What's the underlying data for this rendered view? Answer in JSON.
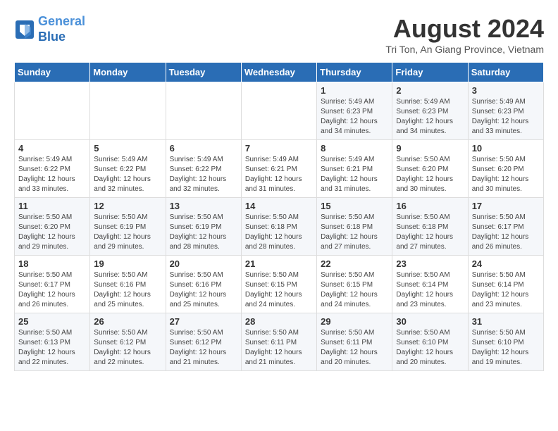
{
  "header": {
    "logo_line1": "General",
    "logo_line2": "Blue",
    "title": "August 2024",
    "subtitle": "Tri Ton, An Giang Province, Vietnam"
  },
  "calendar": {
    "weekdays": [
      "Sunday",
      "Monday",
      "Tuesday",
      "Wednesday",
      "Thursday",
      "Friday",
      "Saturday"
    ],
    "weeks": [
      [
        {
          "day": "",
          "detail": ""
        },
        {
          "day": "",
          "detail": ""
        },
        {
          "day": "",
          "detail": ""
        },
        {
          "day": "",
          "detail": ""
        },
        {
          "day": "1",
          "detail": "Sunrise: 5:49 AM\nSunset: 6:23 PM\nDaylight: 12 hours\nand 34 minutes."
        },
        {
          "day": "2",
          "detail": "Sunrise: 5:49 AM\nSunset: 6:23 PM\nDaylight: 12 hours\nand 34 minutes."
        },
        {
          "day": "3",
          "detail": "Sunrise: 5:49 AM\nSunset: 6:23 PM\nDaylight: 12 hours\nand 33 minutes."
        }
      ],
      [
        {
          "day": "4",
          "detail": "Sunrise: 5:49 AM\nSunset: 6:22 PM\nDaylight: 12 hours\nand 33 minutes."
        },
        {
          "day": "5",
          "detail": "Sunrise: 5:49 AM\nSunset: 6:22 PM\nDaylight: 12 hours\nand 32 minutes."
        },
        {
          "day": "6",
          "detail": "Sunrise: 5:49 AM\nSunset: 6:22 PM\nDaylight: 12 hours\nand 32 minutes."
        },
        {
          "day": "7",
          "detail": "Sunrise: 5:49 AM\nSunset: 6:21 PM\nDaylight: 12 hours\nand 31 minutes."
        },
        {
          "day": "8",
          "detail": "Sunrise: 5:49 AM\nSunset: 6:21 PM\nDaylight: 12 hours\nand 31 minutes."
        },
        {
          "day": "9",
          "detail": "Sunrise: 5:50 AM\nSunset: 6:20 PM\nDaylight: 12 hours\nand 30 minutes."
        },
        {
          "day": "10",
          "detail": "Sunrise: 5:50 AM\nSunset: 6:20 PM\nDaylight: 12 hours\nand 30 minutes."
        }
      ],
      [
        {
          "day": "11",
          "detail": "Sunrise: 5:50 AM\nSunset: 6:20 PM\nDaylight: 12 hours\nand 29 minutes."
        },
        {
          "day": "12",
          "detail": "Sunrise: 5:50 AM\nSunset: 6:19 PM\nDaylight: 12 hours\nand 29 minutes."
        },
        {
          "day": "13",
          "detail": "Sunrise: 5:50 AM\nSunset: 6:19 PM\nDaylight: 12 hours\nand 28 minutes."
        },
        {
          "day": "14",
          "detail": "Sunrise: 5:50 AM\nSunset: 6:18 PM\nDaylight: 12 hours\nand 28 minutes."
        },
        {
          "day": "15",
          "detail": "Sunrise: 5:50 AM\nSunset: 6:18 PM\nDaylight: 12 hours\nand 27 minutes."
        },
        {
          "day": "16",
          "detail": "Sunrise: 5:50 AM\nSunset: 6:18 PM\nDaylight: 12 hours\nand 27 minutes."
        },
        {
          "day": "17",
          "detail": "Sunrise: 5:50 AM\nSunset: 6:17 PM\nDaylight: 12 hours\nand 26 minutes."
        }
      ],
      [
        {
          "day": "18",
          "detail": "Sunrise: 5:50 AM\nSunset: 6:17 PM\nDaylight: 12 hours\nand 26 minutes."
        },
        {
          "day": "19",
          "detail": "Sunrise: 5:50 AM\nSunset: 6:16 PM\nDaylight: 12 hours\nand 25 minutes."
        },
        {
          "day": "20",
          "detail": "Sunrise: 5:50 AM\nSunset: 6:16 PM\nDaylight: 12 hours\nand 25 minutes."
        },
        {
          "day": "21",
          "detail": "Sunrise: 5:50 AM\nSunset: 6:15 PM\nDaylight: 12 hours\nand 24 minutes."
        },
        {
          "day": "22",
          "detail": "Sunrise: 5:50 AM\nSunset: 6:15 PM\nDaylight: 12 hours\nand 24 minutes."
        },
        {
          "day": "23",
          "detail": "Sunrise: 5:50 AM\nSunset: 6:14 PM\nDaylight: 12 hours\nand 23 minutes."
        },
        {
          "day": "24",
          "detail": "Sunrise: 5:50 AM\nSunset: 6:14 PM\nDaylight: 12 hours\nand 23 minutes."
        }
      ],
      [
        {
          "day": "25",
          "detail": "Sunrise: 5:50 AM\nSunset: 6:13 PM\nDaylight: 12 hours\nand 22 minutes."
        },
        {
          "day": "26",
          "detail": "Sunrise: 5:50 AM\nSunset: 6:12 PM\nDaylight: 12 hours\nand 22 minutes."
        },
        {
          "day": "27",
          "detail": "Sunrise: 5:50 AM\nSunset: 6:12 PM\nDaylight: 12 hours\nand 21 minutes."
        },
        {
          "day": "28",
          "detail": "Sunrise: 5:50 AM\nSunset: 6:11 PM\nDaylight: 12 hours\nand 21 minutes."
        },
        {
          "day": "29",
          "detail": "Sunrise: 5:50 AM\nSunset: 6:11 PM\nDaylight: 12 hours\nand 20 minutes."
        },
        {
          "day": "30",
          "detail": "Sunrise: 5:50 AM\nSunset: 6:10 PM\nDaylight: 12 hours\nand 20 minutes."
        },
        {
          "day": "31",
          "detail": "Sunrise: 5:50 AM\nSunset: 6:10 PM\nDaylight: 12 hours\nand 19 minutes."
        }
      ]
    ]
  }
}
